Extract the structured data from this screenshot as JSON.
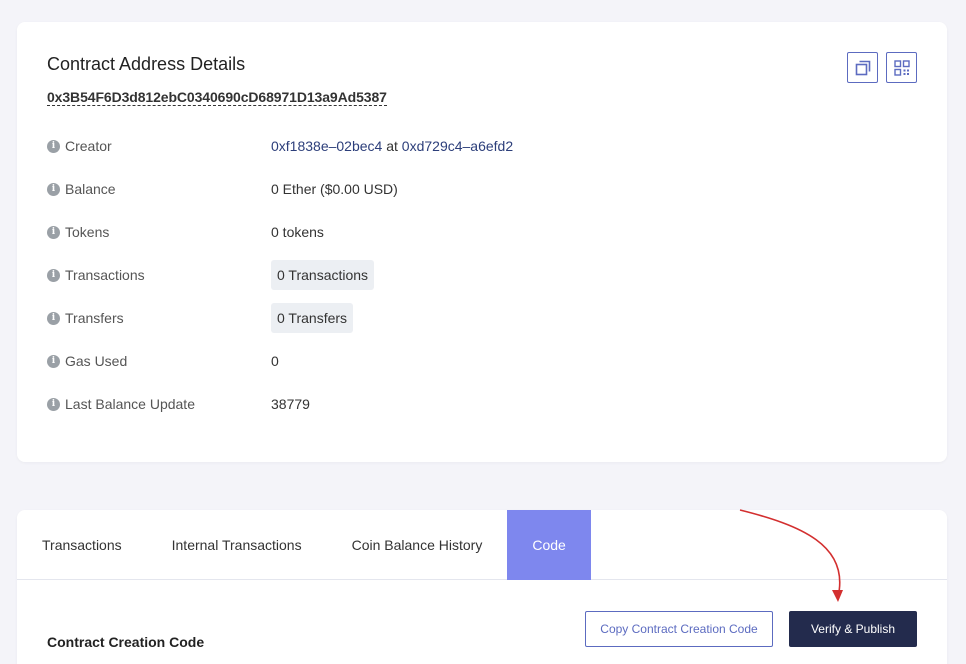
{
  "details": {
    "title": "Contract Address Details",
    "address": "0x3B54F6D3d812ebC0340690cD68971D13a9Ad5387",
    "rows": [
      {
        "label": "Creator",
        "value_parts": [
          "0xf1838e–02bec4",
          " at ",
          "0xd729c4–a6efd2"
        ]
      },
      {
        "label": "Balance",
        "value": "0 Ether ($0.00 USD)"
      },
      {
        "label": "Tokens",
        "value": "0 tokens"
      },
      {
        "label": "Transactions",
        "value": "0 Transactions"
      },
      {
        "label": "Transfers",
        "value": "0 Transfers"
      },
      {
        "label": "Gas Used",
        "value": "0"
      },
      {
        "label": "Last Balance Update",
        "value": "38779"
      }
    ],
    "icons": {
      "copy": "copy-icon",
      "qr": "qr-code-icon",
      "info": "info-icon"
    }
  },
  "tabs": {
    "items": [
      {
        "label": "Transactions",
        "active": false
      },
      {
        "label": "Internal Transactions",
        "active": false
      },
      {
        "label": "Coin Balance History",
        "active": false
      },
      {
        "label": "Code",
        "active": true
      }
    ]
  },
  "code": {
    "section_title": "Contract Creation Code",
    "copy_button": "Copy Contract Creation Code",
    "verify_button": "Verify & Publish"
  },
  "colors": {
    "accent": "#7e87ee",
    "primary_dark": "#232b4d",
    "link": "#2c3e7a",
    "annotation_arrow": "#d32f2f"
  }
}
